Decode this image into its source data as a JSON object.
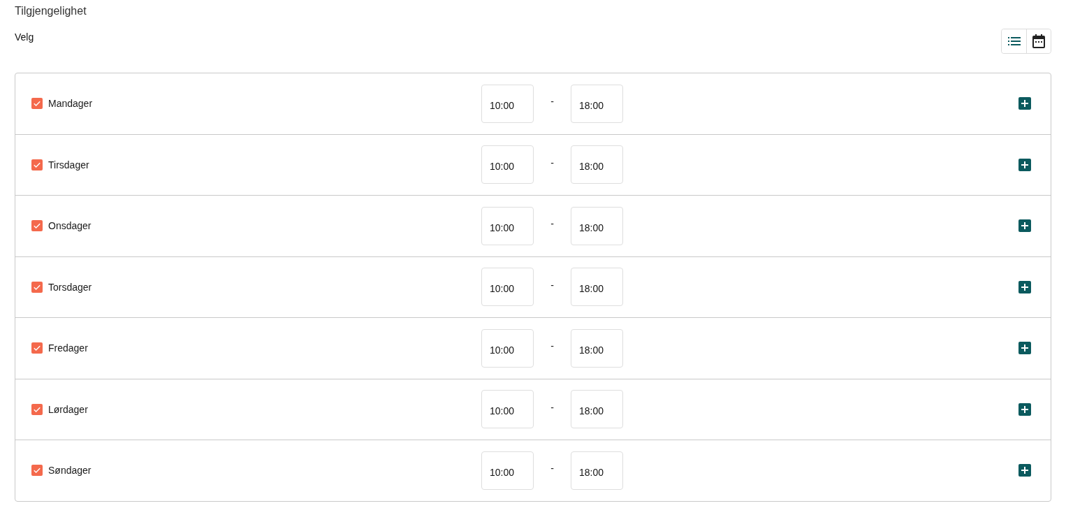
{
  "title": "Tilgjengelighet",
  "subtitle": "Velg",
  "view_toggle": [
    {
      "kind": "list",
      "selected": true
    },
    {
      "kind": "calendar",
      "selected": false
    }
  ],
  "days": [
    {
      "name": "Mandager",
      "checked": true,
      "start": "10:00",
      "separator": "-",
      "end": "18:00"
    },
    {
      "name": "Tirsdager",
      "checked": true,
      "start": "10:00",
      "separator": "-",
      "end": "18:00"
    },
    {
      "name": "Onsdager",
      "checked": true,
      "start": "10:00",
      "separator": "-",
      "end": "18:00"
    },
    {
      "name": "Torsdager",
      "checked": true,
      "start": "10:00",
      "separator": "-",
      "end": "18:00"
    },
    {
      "name": "Fredager",
      "checked": true,
      "start": "10:00",
      "separator": "-",
      "end": "18:00"
    },
    {
      "name": "Lørdager",
      "checked": true,
      "start": "10:00",
      "separator": "-",
      "end": "18:00"
    },
    {
      "name": "Søndager",
      "checked": true,
      "start": "10:00",
      "separator": "-",
      "end": "18:00"
    }
  ]
}
